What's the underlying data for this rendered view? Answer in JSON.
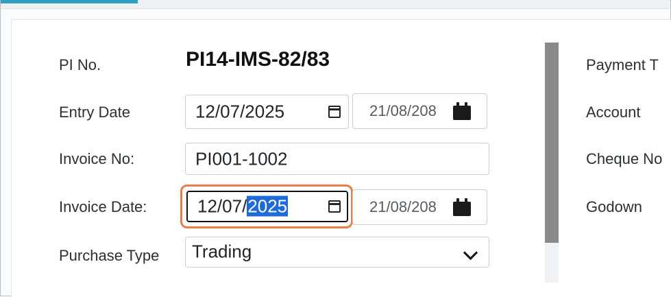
{
  "form": {
    "pi_no_label": "PI No.",
    "pi_no_value": "PI14-IMS-82/83",
    "entry_date_label": "Entry Date",
    "entry_date_value": "12/07/2025",
    "entry_date_alt": "21/08/208",
    "invoice_no_label": "Invoice No:",
    "invoice_no_value": "PI001-1002",
    "invoice_date_label": "Invoice Date:",
    "invoice_date_day_month": "12/07/",
    "invoice_date_year_selected": "2025",
    "invoice_date_alt": "21/08/208",
    "purchase_type_label": "Purchase Type",
    "purchase_type_selected": "Trading"
  },
  "right_column": {
    "payment_label": "Payment T",
    "account_label": "Account",
    "cheque_label": "Cheque No",
    "godown_label": "Godown"
  },
  "icons": {
    "calendar": "calendar-icon",
    "calendar_solid": "calendar-solid-icon",
    "chevron": "chevron-down-icon"
  },
  "colors": {
    "accent": "#2e9fc2",
    "focus_ring": "#ea7d47",
    "selection": "#1e6ad6"
  }
}
